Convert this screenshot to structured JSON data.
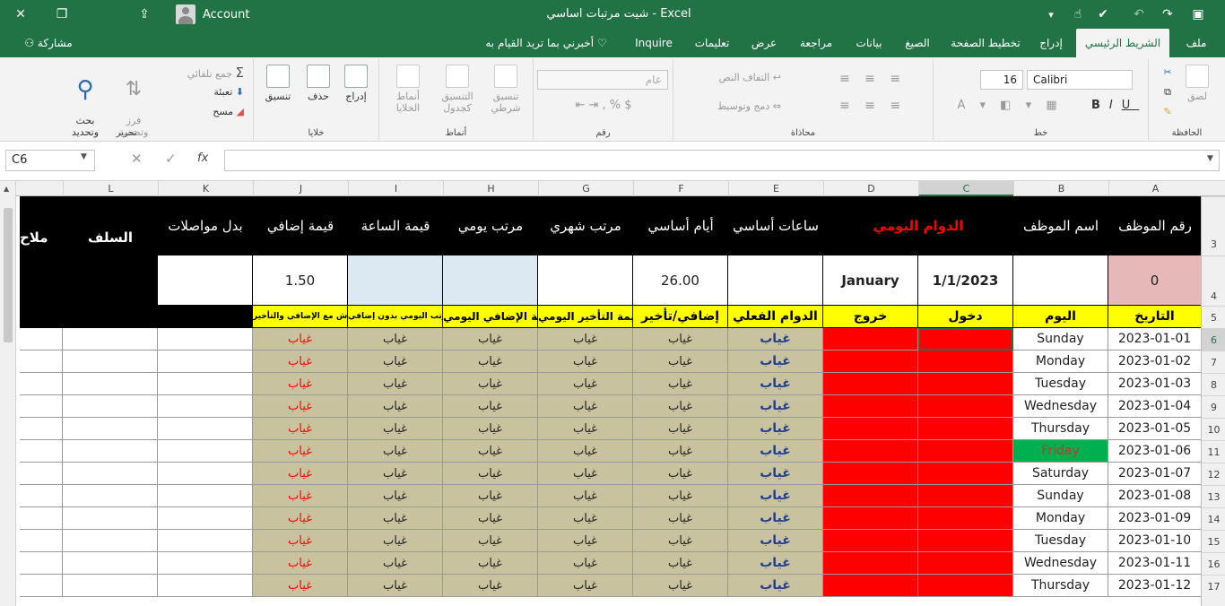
{
  "titlebar": {
    "title": "شيت مرتبات اساسي  -   Excel",
    "account": "Account"
  },
  "tabs": [
    {
      "label": "ملف"
    },
    {
      "label": "الشريط الرئيسي"
    },
    {
      "label": "إدراج"
    },
    {
      "label": "تخطيط الصفحة"
    },
    {
      "label": "الصيغ"
    },
    {
      "label": "بيانات"
    },
    {
      "label": "مراجعة"
    },
    {
      "label": "عرض"
    },
    {
      "label": "تعليمات"
    },
    {
      "label": "Inquire"
    },
    {
      "label": "أخبرني بما تريد القيام به"
    },
    {
      "label": "مشاركة"
    }
  ],
  "ribbon": {
    "clipboard": {
      "label": "الحافظة",
      "paste": "لصق"
    },
    "font": {
      "label": "خط",
      "name": "Calibri",
      "size": "16",
      "bold": "B",
      "italic": "I",
      "underline": "U"
    },
    "alignment": {
      "label": "محاذاة",
      "wrap": "التفاف النص",
      "merge": "دمج وتوسيط"
    },
    "number": {
      "label": "رقم",
      "format": "عام"
    },
    "styles": {
      "label": "أنماط",
      "conditional": "تنسيق\nشرطي",
      "as_table": "التنسيق\nكجدول",
      "cell_styles": "أنماط\nالخلايا"
    },
    "cells": {
      "label": "خلايا",
      "insert": "إدراج",
      "delete": "حذف",
      "format": "تنسيق"
    },
    "editing": {
      "label": "تحرير",
      "autosum": "جمع تلقائي",
      "fill": "تعبئة",
      "clear": "مسح",
      "sort": "فرز\nوتصفية",
      "find": "بحث\nوتحديد"
    }
  },
  "formula": {
    "namebox": "C6",
    "fx": "fx"
  },
  "columns": [
    "A",
    "B",
    "C",
    "D",
    "E",
    "F",
    "G",
    "H",
    "I",
    "J",
    "K",
    "L"
  ],
  "rows": [
    "3",
    "4",
    "5",
    "6",
    "7",
    "8",
    "9",
    "10",
    "11",
    "12",
    "13",
    "14",
    "15",
    "16",
    "17"
  ],
  "header3": {
    "A": "رقم الموظف",
    "B": "اسم الموظف",
    "CD": "الدوام اليومي",
    "E": "ساعات أساسي",
    "F": "أيام أساسي",
    "G": "مرتب شهري",
    "H": "مرتب يومي",
    "I": "قيمة الساعة",
    "J": "قيمة إضافي",
    "K": "بدل مواصلات",
    "L": "السلف",
    "M": "ملاح"
  },
  "row4": {
    "A": "0",
    "B": "",
    "C": "1/1/2023",
    "D": "January",
    "E": "",
    "F": "26.00",
    "G": "",
    "H": "",
    "I": "",
    "J": "1.50",
    "K": ""
  },
  "header5": {
    "A": "التاريخ",
    "B": "اليوم",
    "C": "دخول",
    "D": "خروج",
    "E": "الدوام الفعلي",
    "F": "إضافي/تأخير",
    "G": "قيمة التأخير اليومي",
    "H": "قيمة الإضافي اليومي",
    "I": "المرتب اليومي بدون إضافي",
    "J": "المعاش مع الإضافي والتأخير"
  },
  "absent": "غياب",
  "days": [
    {
      "date": "2023-01-01",
      "day": "Sunday",
      "weekend": false
    },
    {
      "date": "2023-01-02",
      "day": "Monday",
      "weekend": false
    },
    {
      "date": "2023-01-03",
      "day": "Tuesday",
      "weekend": false
    },
    {
      "date": "2023-01-04",
      "day": "Wednesday",
      "weekend": false
    },
    {
      "date": "2023-01-05",
      "day": "Thursday",
      "weekend": false
    },
    {
      "date": "2023-01-06",
      "day": "Friday",
      "weekend": true
    },
    {
      "date": "2023-01-07",
      "day": "Saturday",
      "weekend": false
    },
    {
      "date": "2023-01-08",
      "day": "Sunday",
      "weekend": false
    },
    {
      "date": "2023-01-09",
      "day": "Monday",
      "weekend": false
    },
    {
      "date": "2023-01-10",
      "day": "Tuesday",
      "weekend": false
    },
    {
      "date": "2023-01-11",
      "day": "Wednesday",
      "weekend": false
    },
    {
      "date": "2023-01-12",
      "day": "Thursday",
      "weekend": false
    }
  ],
  "colors": {
    "excel_green": "#217346",
    "header_black": "#000000",
    "header_yellow": "#ffff00",
    "red_fill": "#ff0000",
    "tan_fill": "#c8c29e",
    "friday_green": "#00b050",
    "absent_blue": "#1f3f8f",
    "absent_red": "#ff0000"
  }
}
